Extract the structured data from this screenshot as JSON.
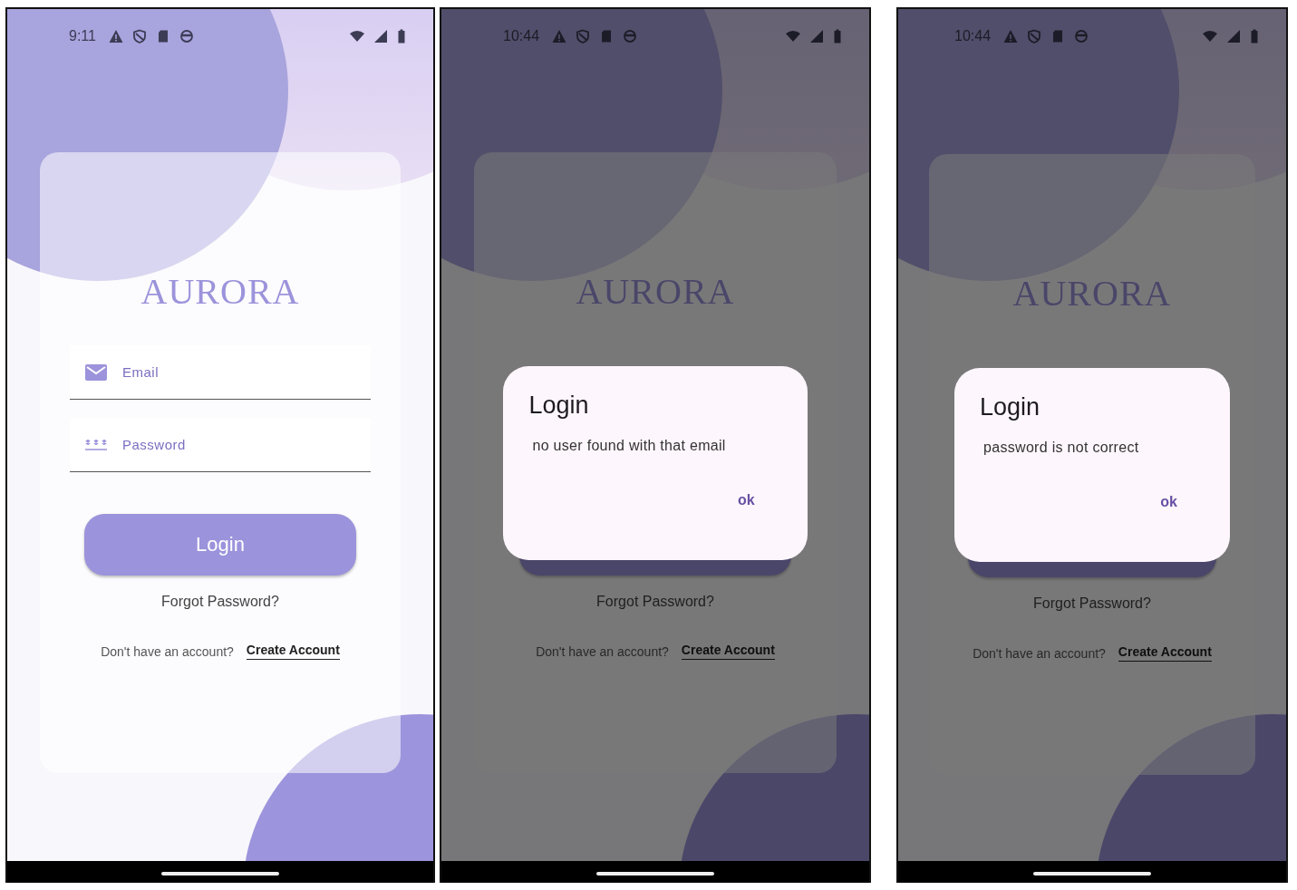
{
  "screens": [
    {
      "status_bar": {
        "time": "9:11"
      },
      "logo": "AURORA",
      "fields": [
        {
          "kind": "email",
          "placeholder": "Email"
        },
        {
          "kind": "password",
          "placeholder": "Password"
        }
      ],
      "login_button": {
        "label": "Login"
      },
      "forgot_link": "Forgot Password?",
      "signup_prompt": "Don't have an account?",
      "create_account_link": "Create Account"
    },
    {
      "status_bar": {
        "time": "10:44"
      },
      "logo": "AURORA",
      "forgot_link": "Forgot Password?",
      "signup_prompt": "Don't have an account?",
      "create_account_link": "Create Account",
      "dialog": {
        "title": "Login",
        "message": "no user found with that email",
        "button": "ok"
      }
    },
    {
      "status_bar": {
        "time": "10:44"
      },
      "logo": "AURORA",
      "forgot_link": "Forgot Password?",
      "signup_prompt": "Don't have an account?",
      "create_account_link": "Create Account",
      "dialog": {
        "title": "Login",
        "message": "password is not correct",
        "button": "ok"
      }
    }
  ]
}
